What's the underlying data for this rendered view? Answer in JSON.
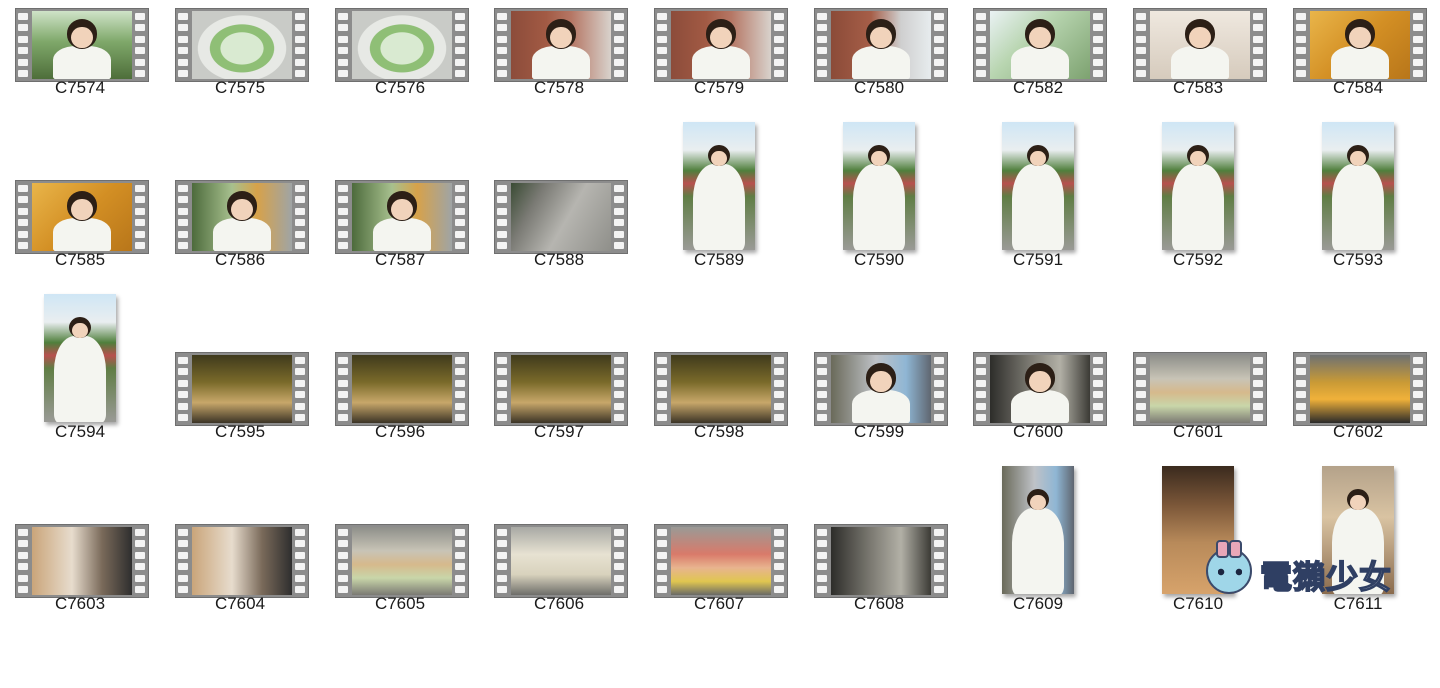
{
  "items": [
    {
      "name": "C7574",
      "kind": "video",
      "scene": "outdoor-green",
      "person": true
    },
    {
      "name": "C7575",
      "kind": "video",
      "scene": "salad",
      "person": false
    },
    {
      "name": "C7576",
      "kind": "video",
      "scene": "salad",
      "person": false
    },
    {
      "name": "C7578",
      "kind": "video",
      "scene": "brick",
      "person": true
    },
    {
      "name": "C7579",
      "kind": "video",
      "scene": "brick",
      "person": true
    },
    {
      "name": "C7580",
      "kind": "video",
      "scene": "brick-window",
      "person": true
    },
    {
      "name": "C7582",
      "kind": "video",
      "scene": "outdoor-bright",
      "person": true
    },
    {
      "name": "C7583",
      "kind": "video",
      "scene": "cafe-light",
      "person": true
    },
    {
      "name": "C7584",
      "kind": "video",
      "scene": "gold-poster",
      "person": true
    },
    {
      "name": "C7585",
      "kind": "video",
      "scene": "gold-poster",
      "person": true
    },
    {
      "name": "C7586",
      "kind": "video",
      "scene": "truck",
      "person": true
    },
    {
      "name": "C7587",
      "kind": "video",
      "scene": "truck",
      "person": true
    },
    {
      "name": "C7588",
      "kind": "video",
      "scene": "pavement",
      "person": false
    },
    {
      "name": "C7589",
      "kind": "photo",
      "scene": "garden",
      "person": true
    },
    {
      "name": "C7590",
      "kind": "photo",
      "scene": "garden",
      "person": true
    },
    {
      "name": "C7591",
      "kind": "photo",
      "scene": "garden",
      "person": true
    },
    {
      "name": "C7592",
      "kind": "photo",
      "scene": "garden",
      "person": true
    },
    {
      "name": "C7593",
      "kind": "photo",
      "scene": "garden",
      "person": true
    },
    {
      "name": "C7594",
      "kind": "photo",
      "scene": "garden",
      "person": true
    },
    {
      "name": "C7595",
      "kind": "video",
      "scene": "venchi",
      "person": false
    },
    {
      "name": "C7596",
      "kind": "video",
      "scene": "venchi",
      "person": false
    },
    {
      "name": "C7597",
      "kind": "video",
      "scene": "venchi",
      "person": false
    },
    {
      "name": "C7598",
      "kind": "video",
      "scene": "venchi",
      "person": false
    },
    {
      "name": "C7599",
      "kind": "video",
      "scene": "store",
      "person": true
    },
    {
      "name": "C7600",
      "kind": "video",
      "scene": "store-dark",
      "person": true
    },
    {
      "name": "C7601",
      "kind": "video",
      "scene": "gelato",
      "person": false
    },
    {
      "name": "C7602",
      "kind": "video",
      "scene": "gelato-yellow",
      "person": false
    },
    {
      "name": "C7603",
      "kind": "video",
      "scene": "counter",
      "person": false
    },
    {
      "name": "C7604",
      "kind": "video",
      "scene": "counter",
      "person": false
    },
    {
      "name": "C7605",
      "kind": "video",
      "scene": "gelato",
      "person": false
    },
    {
      "name": "C7606",
      "kind": "video",
      "scene": "gelato-white",
      "person": false
    },
    {
      "name": "C7607",
      "kind": "video",
      "scene": "gelato-pink",
      "person": false
    },
    {
      "name": "C7608",
      "kind": "video",
      "scene": "store-dark",
      "person": false
    },
    {
      "name": "C7609",
      "kind": "photo",
      "scene": "store",
      "person": true
    },
    {
      "name": "C7610",
      "kind": "photo",
      "scene": "wood-ceiling",
      "person": false
    },
    {
      "name": "C7611",
      "kind": "photo",
      "scene": "store-wood",
      "person": true
    }
  ],
  "watermark": {
    "text": "電獺少女"
  }
}
